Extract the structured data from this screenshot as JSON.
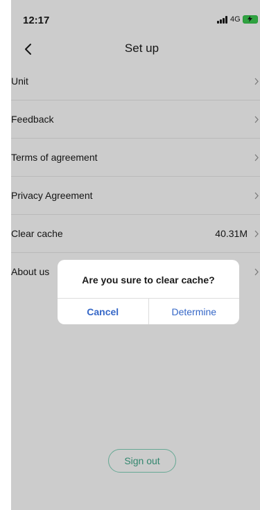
{
  "status_bar": {
    "time": "12:17",
    "network": "4G"
  },
  "nav": {
    "title": "Set up"
  },
  "settings": {
    "items": [
      {
        "label": "Unit",
        "value": ""
      },
      {
        "label": "Feedback",
        "value": ""
      },
      {
        "label": "Terms of agreement",
        "value": ""
      },
      {
        "label": "Privacy Agreement",
        "value": ""
      },
      {
        "label": "Clear cache",
        "value": "40.31M"
      },
      {
        "label": "About us",
        "value": ""
      }
    ]
  },
  "footer": {
    "sign_out_label": "Sign out"
  },
  "dialog": {
    "message": "Are you sure to clear cache?",
    "cancel_label": "Cancel",
    "confirm_label": "Determine"
  },
  "colors": {
    "accent": "#3567c7",
    "sign_out": "#3fa88a",
    "battery": "#3ccb52"
  }
}
